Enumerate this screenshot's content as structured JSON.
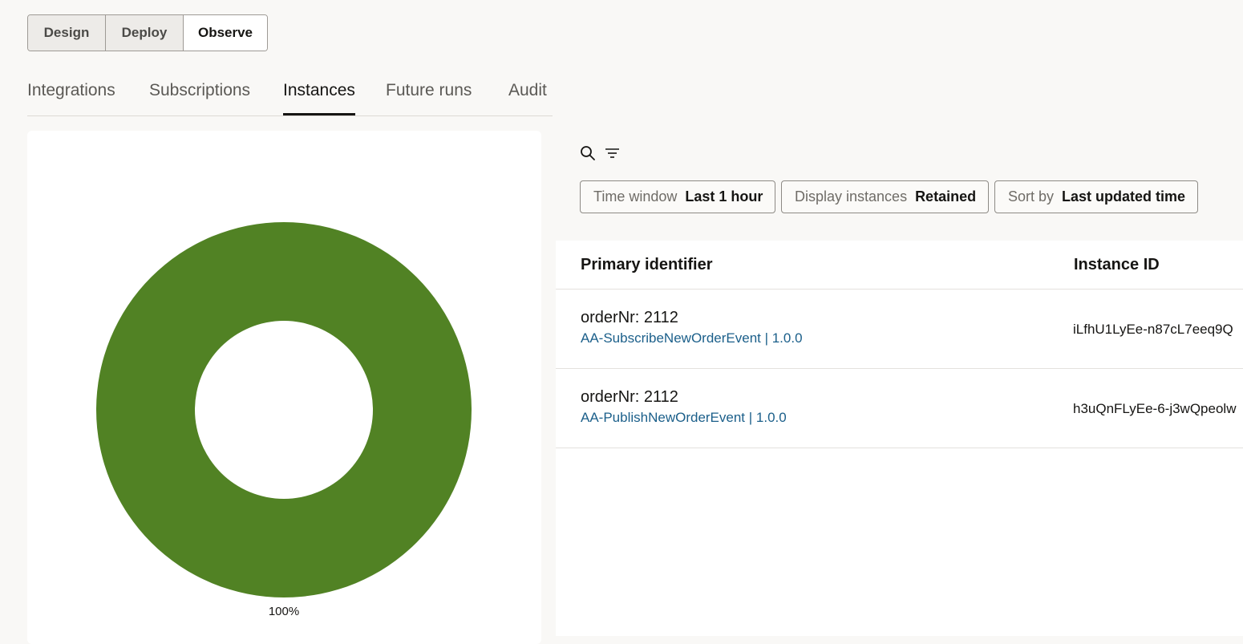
{
  "segmented": {
    "design_label": "Design",
    "deploy_label": "Deploy",
    "observe_label": "Observe",
    "selected": "Observe"
  },
  "tabs": [
    {
      "label": "Integrations"
    },
    {
      "label": "Subscriptions"
    },
    {
      "label": "Instances",
      "active": true
    },
    {
      "label": "Future runs"
    },
    {
      "label": "Audit"
    }
  ],
  "toolbar": {
    "search_icon": "search-icon",
    "filter_icon": "filter-icon"
  },
  "filters": {
    "time_window": {
      "label": "Time window",
      "value": "Last 1 hour"
    },
    "display_instances": {
      "label": "Display instances",
      "value": "Retained"
    },
    "sort_by": {
      "label": "Sort by",
      "value": "Last updated time"
    }
  },
  "table": {
    "columns": [
      "Primary identifier",
      "Instance ID"
    ],
    "rows": [
      {
        "primary": "orderNr: 2112",
        "integration": "AA-SubscribeNewOrderEvent | 1.0.0",
        "instance_id": "iLfhU1LyEe-n87cL7eeq9Q"
      },
      {
        "primary": "orderNr: 2112",
        "integration": "AA-PublishNewOrderEvent | 1.0.0",
        "instance_id": "h3uQnFLyEe-6-j3wQpeolw"
      }
    ]
  },
  "chart_data": {
    "type": "pie",
    "donut": true,
    "slices": [
      {
        "value": 100,
        "color": "#518224",
        "label": "100%"
      }
    ]
  },
  "colors": {
    "accent": "#161513",
    "link": "#1b5f8a",
    "donut_green": "#518224"
  }
}
